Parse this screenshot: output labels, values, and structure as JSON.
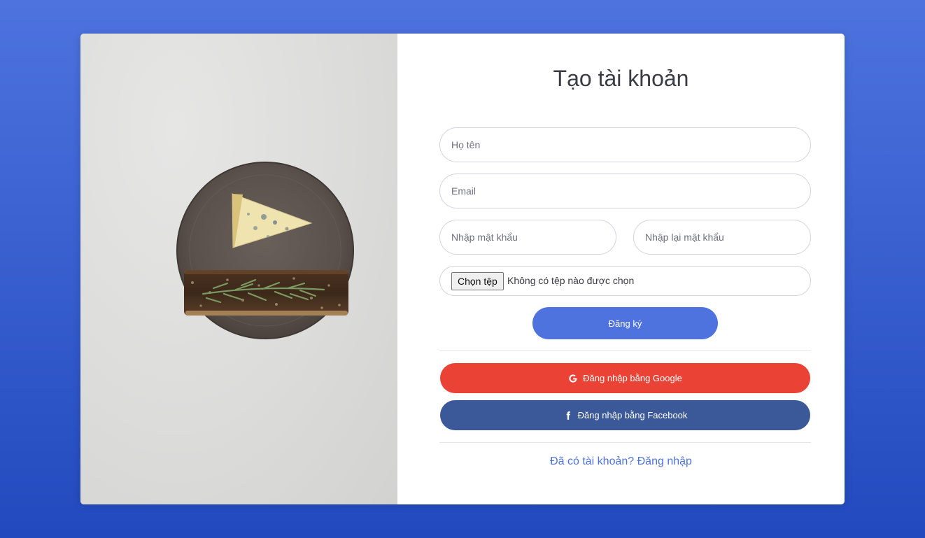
{
  "title": "Tạo tài khoản",
  "fields": {
    "fullname_placeholder": "Họ tên",
    "email_placeholder": "Email",
    "password_placeholder": "Nhập mật khẩu",
    "password_repeat_placeholder": "Nhập lại mật khẩu",
    "file_button_label": "Chọn tệp",
    "file_status": "Không có tệp nào được chọn"
  },
  "buttons": {
    "register": "Đăng ký",
    "google": "Đăng nhập bằng Google",
    "facebook": "Đăng nhập bằng Facebook"
  },
  "footer": {
    "login_link": "Đã có tài khoản? Đăng nhập"
  },
  "colors": {
    "primary": "#4e73df",
    "google": "#ea4335",
    "facebook": "#3b5998"
  },
  "icons": {
    "google": "google-icon",
    "facebook": "facebook-icon"
  }
}
